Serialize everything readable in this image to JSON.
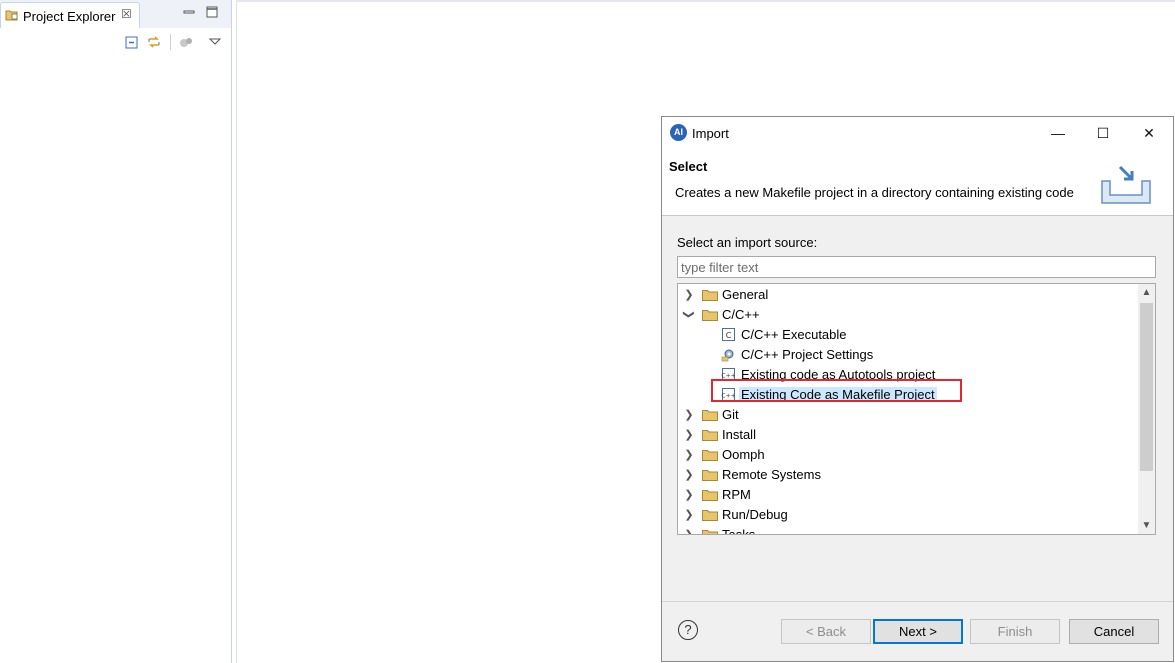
{
  "explorer": {
    "tab_label": "Project Explorer",
    "close_glyph": "☒"
  },
  "dialog": {
    "title": "Import",
    "app_icon_text": "AI",
    "banner": {
      "heading": "Select",
      "description": "Creates a new Makefile project in a directory containing existing code"
    },
    "source_label": "Select an import source:",
    "filter_placeholder": "type filter text",
    "tree": {
      "items": [
        {
          "label": "General",
          "expanded": false,
          "type": "folder"
        },
        {
          "label": "C/C++",
          "expanded": true,
          "type": "folder"
        },
        {
          "label": "C/C++ Executable",
          "type": "child",
          "icon": "c-file-icon"
        },
        {
          "label": "C/C++ Project Settings",
          "type": "child",
          "icon": "settings-icon"
        },
        {
          "label": "Existing code as Autotools project",
          "type": "child",
          "icon": "cpp-file-icon"
        },
        {
          "label": "Existing Code as Makefile Project",
          "type": "child",
          "icon": "cpp-file-icon",
          "selected": true
        },
        {
          "label": "Git",
          "expanded": false,
          "type": "folder"
        },
        {
          "label": "Install",
          "expanded": false,
          "type": "folder"
        },
        {
          "label": "Oomph",
          "expanded": false,
          "type": "folder"
        },
        {
          "label": "Remote Systems",
          "expanded": false,
          "type": "folder"
        },
        {
          "label": "RPM",
          "expanded": false,
          "type": "folder"
        },
        {
          "label": "Run/Debug",
          "expanded": false,
          "type": "folder"
        },
        {
          "label": "Tasks",
          "expanded": false,
          "type": "folder"
        }
      ]
    },
    "buttons": {
      "help": "?",
      "back": "< Back",
      "next": "Next >",
      "finish": "Finish",
      "cancel": "Cancel"
    },
    "window_controls": {
      "minimize": "—",
      "maximize": "☐",
      "close": "✕"
    }
  },
  "colors": {
    "selection": "#cce8ff",
    "highlight_box": "#e0282e",
    "default_button_border": "#0078d7",
    "folder": "#e8c46a"
  }
}
